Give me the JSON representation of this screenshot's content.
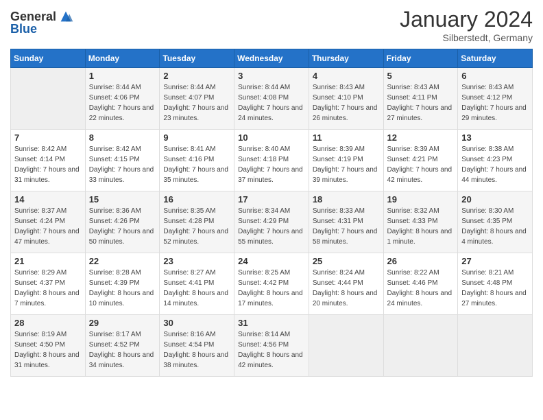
{
  "header": {
    "logo_general": "General",
    "logo_blue": "Blue",
    "title": "January 2024",
    "location": "Silberstedt, Germany"
  },
  "days_of_week": [
    "Sunday",
    "Monday",
    "Tuesday",
    "Wednesday",
    "Thursday",
    "Friday",
    "Saturday"
  ],
  "weeks": [
    [
      {
        "day": "",
        "empty": true
      },
      {
        "day": "1",
        "sunrise": "Sunrise: 8:44 AM",
        "sunset": "Sunset: 4:06 PM",
        "daylight": "Daylight: 7 hours and 22 minutes."
      },
      {
        "day": "2",
        "sunrise": "Sunrise: 8:44 AM",
        "sunset": "Sunset: 4:07 PM",
        "daylight": "Daylight: 7 hours and 23 minutes."
      },
      {
        "day": "3",
        "sunrise": "Sunrise: 8:44 AM",
        "sunset": "Sunset: 4:08 PM",
        "daylight": "Daylight: 7 hours and 24 minutes."
      },
      {
        "day": "4",
        "sunrise": "Sunrise: 8:43 AM",
        "sunset": "Sunset: 4:10 PM",
        "daylight": "Daylight: 7 hours and 26 minutes."
      },
      {
        "day": "5",
        "sunrise": "Sunrise: 8:43 AM",
        "sunset": "Sunset: 4:11 PM",
        "daylight": "Daylight: 7 hours and 27 minutes."
      },
      {
        "day": "6",
        "sunrise": "Sunrise: 8:43 AM",
        "sunset": "Sunset: 4:12 PM",
        "daylight": "Daylight: 7 hours and 29 minutes."
      }
    ],
    [
      {
        "day": "7",
        "sunrise": "Sunrise: 8:42 AM",
        "sunset": "Sunset: 4:14 PM",
        "daylight": "Daylight: 7 hours and 31 minutes."
      },
      {
        "day": "8",
        "sunrise": "Sunrise: 8:42 AM",
        "sunset": "Sunset: 4:15 PM",
        "daylight": "Daylight: 7 hours and 33 minutes."
      },
      {
        "day": "9",
        "sunrise": "Sunrise: 8:41 AM",
        "sunset": "Sunset: 4:16 PM",
        "daylight": "Daylight: 7 hours and 35 minutes."
      },
      {
        "day": "10",
        "sunrise": "Sunrise: 8:40 AM",
        "sunset": "Sunset: 4:18 PM",
        "daylight": "Daylight: 7 hours and 37 minutes."
      },
      {
        "day": "11",
        "sunrise": "Sunrise: 8:39 AM",
        "sunset": "Sunset: 4:19 PM",
        "daylight": "Daylight: 7 hours and 39 minutes."
      },
      {
        "day": "12",
        "sunrise": "Sunrise: 8:39 AM",
        "sunset": "Sunset: 4:21 PM",
        "daylight": "Daylight: 7 hours and 42 minutes."
      },
      {
        "day": "13",
        "sunrise": "Sunrise: 8:38 AM",
        "sunset": "Sunset: 4:23 PM",
        "daylight": "Daylight: 7 hours and 44 minutes."
      }
    ],
    [
      {
        "day": "14",
        "sunrise": "Sunrise: 8:37 AM",
        "sunset": "Sunset: 4:24 PM",
        "daylight": "Daylight: 7 hours and 47 minutes."
      },
      {
        "day": "15",
        "sunrise": "Sunrise: 8:36 AM",
        "sunset": "Sunset: 4:26 PM",
        "daylight": "Daylight: 7 hours and 50 minutes."
      },
      {
        "day": "16",
        "sunrise": "Sunrise: 8:35 AM",
        "sunset": "Sunset: 4:28 PM",
        "daylight": "Daylight: 7 hours and 52 minutes."
      },
      {
        "day": "17",
        "sunrise": "Sunrise: 8:34 AM",
        "sunset": "Sunset: 4:29 PM",
        "daylight": "Daylight: 7 hours and 55 minutes."
      },
      {
        "day": "18",
        "sunrise": "Sunrise: 8:33 AM",
        "sunset": "Sunset: 4:31 PM",
        "daylight": "Daylight: 7 hours and 58 minutes."
      },
      {
        "day": "19",
        "sunrise": "Sunrise: 8:32 AM",
        "sunset": "Sunset: 4:33 PM",
        "daylight": "Daylight: 8 hours and 1 minute."
      },
      {
        "day": "20",
        "sunrise": "Sunrise: 8:30 AM",
        "sunset": "Sunset: 4:35 PM",
        "daylight": "Daylight: 8 hours and 4 minutes."
      }
    ],
    [
      {
        "day": "21",
        "sunrise": "Sunrise: 8:29 AM",
        "sunset": "Sunset: 4:37 PM",
        "daylight": "Daylight: 8 hours and 7 minutes."
      },
      {
        "day": "22",
        "sunrise": "Sunrise: 8:28 AM",
        "sunset": "Sunset: 4:39 PM",
        "daylight": "Daylight: 8 hours and 10 minutes."
      },
      {
        "day": "23",
        "sunrise": "Sunrise: 8:27 AM",
        "sunset": "Sunset: 4:41 PM",
        "daylight": "Daylight: 8 hours and 14 minutes."
      },
      {
        "day": "24",
        "sunrise": "Sunrise: 8:25 AM",
        "sunset": "Sunset: 4:42 PM",
        "daylight": "Daylight: 8 hours and 17 minutes."
      },
      {
        "day": "25",
        "sunrise": "Sunrise: 8:24 AM",
        "sunset": "Sunset: 4:44 PM",
        "daylight": "Daylight: 8 hours and 20 minutes."
      },
      {
        "day": "26",
        "sunrise": "Sunrise: 8:22 AM",
        "sunset": "Sunset: 4:46 PM",
        "daylight": "Daylight: 8 hours and 24 minutes."
      },
      {
        "day": "27",
        "sunrise": "Sunrise: 8:21 AM",
        "sunset": "Sunset: 4:48 PM",
        "daylight": "Daylight: 8 hours and 27 minutes."
      }
    ],
    [
      {
        "day": "28",
        "sunrise": "Sunrise: 8:19 AM",
        "sunset": "Sunset: 4:50 PM",
        "daylight": "Daylight: 8 hours and 31 minutes."
      },
      {
        "day": "29",
        "sunrise": "Sunrise: 8:17 AM",
        "sunset": "Sunset: 4:52 PM",
        "daylight": "Daylight: 8 hours and 34 minutes."
      },
      {
        "day": "30",
        "sunrise": "Sunrise: 8:16 AM",
        "sunset": "Sunset: 4:54 PM",
        "daylight": "Daylight: 8 hours and 38 minutes."
      },
      {
        "day": "31",
        "sunrise": "Sunrise: 8:14 AM",
        "sunset": "Sunset: 4:56 PM",
        "daylight": "Daylight: 8 hours and 42 minutes."
      },
      {
        "day": "",
        "empty": true
      },
      {
        "day": "",
        "empty": true
      },
      {
        "day": "",
        "empty": true
      }
    ]
  ]
}
